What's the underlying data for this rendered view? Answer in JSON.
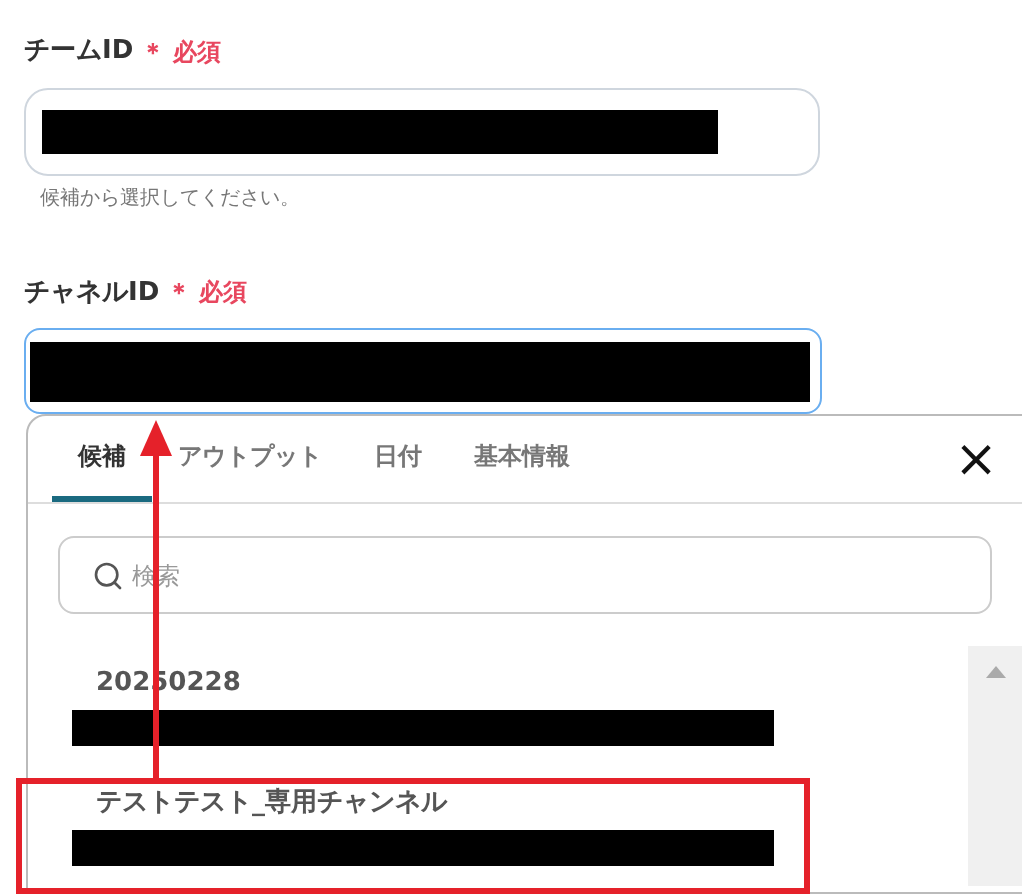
{
  "fields": [
    {
      "label": "チームID",
      "required_mark": "＊",
      "required_text": "必須",
      "hint": "候補から選択してください。",
      "focused": false
    },
    {
      "label": "チャネルID",
      "required_mark": "＊",
      "required_text": "必須",
      "focused": true
    }
  ],
  "dropdown": {
    "tabs": [
      {
        "label": "候補",
        "selected": true
      },
      {
        "label": "アウトプット",
        "selected": false
      },
      {
        "label": "日付",
        "selected": false
      },
      {
        "label": "基本情報",
        "selected": false
      }
    ],
    "close": "×",
    "search": {
      "placeholder": "検索"
    },
    "options": [
      {
        "label": "20250228"
      },
      {
        "label": "テストテスト_専用チャンネル"
      }
    ]
  }
}
